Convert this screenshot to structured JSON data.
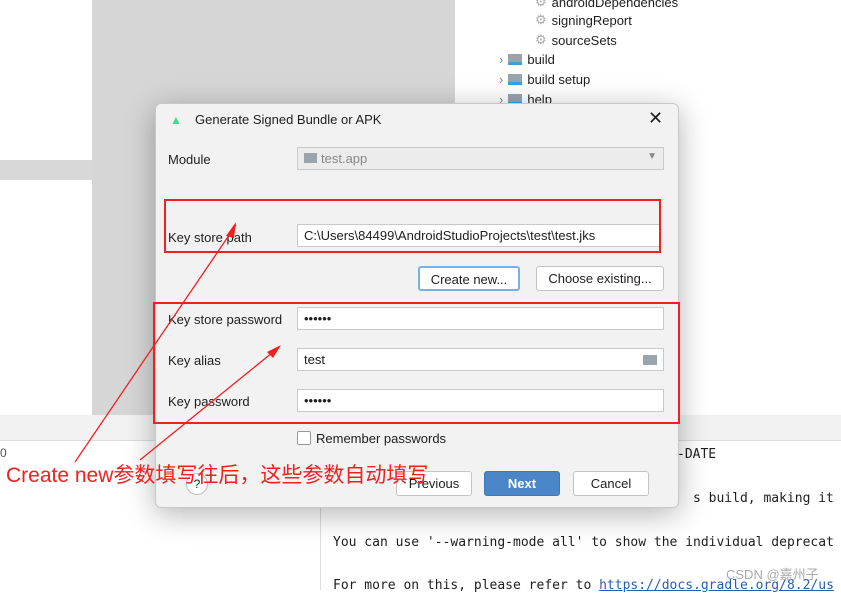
{
  "tree": {
    "items": [
      {
        "label": "androidDependencies",
        "icon": "gear-icon"
      },
      {
        "label": "signingReport",
        "icon": "gear-icon"
      },
      {
        "label": "sourceSets",
        "icon": "gear-icon"
      },
      {
        "label": "build",
        "icon": "gradle-folder-icon"
      },
      {
        "label": "build setup",
        "icon": "gradle-folder-icon"
      },
      {
        "label": "help",
        "icon": "gradle-folder-icon"
      }
    ]
  },
  "console": {
    "left_fragment": "0",
    "lines": [
      "-DATE",
      "s build, making it in",
      "You can use '--warning-mode all' to show the individual deprecat",
      "For more on this, please refer to "
    ],
    "link": "https://docs.gradle.org/8.2/us"
  },
  "dialog": {
    "title": "Generate Signed Bundle or APK",
    "module_label": "Module",
    "module_value": "test.app",
    "keystore_path_label": "Key store path",
    "keystore_path_value": "C:\\Users\\84499\\AndroidStudioProjects\\test\\test.jks",
    "create_new": "Create new...",
    "choose_existing": "Choose existing...",
    "keystore_password_label": "Key store password",
    "keystore_password_value": "••••••",
    "key_alias_label": "Key alias",
    "key_alias_value": "test",
    "key_password_label": "Key password",
    "key_password_value": "••••••",
    "remember": "Remember passwords",
    "remember_checked": false,
    "help": "?",
    "previous": "Previous",
    "next": "Next",
    "cancel": "Cancel",
    "accent": "#4a86c8"
  },
  "annotation": "Create new参数填写往后，这些参数自动填写",
  "watermark": "CSDN @嘉州子"
}
